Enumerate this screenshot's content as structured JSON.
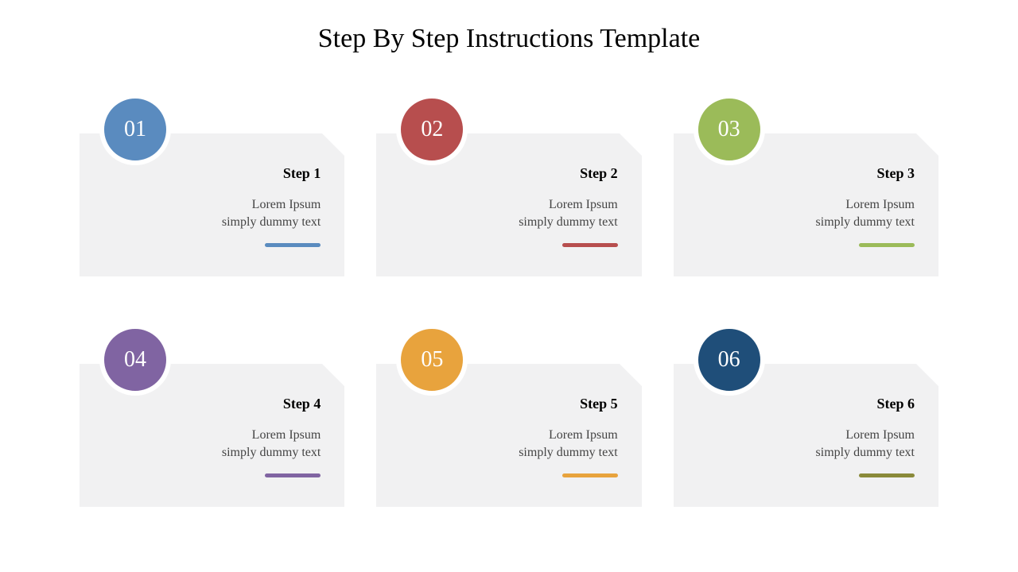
{
  "title": "Step By Step Instructions Template",
  "steps": [
    {
      "num": "01",
      "title": "Step 1",
      "body1": "Lorem Ipsum",
      "body2": "simply dummy text",
      "color": "#5a8bbf"
    },
    {
      "num": "02",
      "title": "Step 2",
      "body1": "Lorem Ipsum",
      "body2": "simply dummy text",
      "color": "#b74e4e"
    },
    {
      "num": "03",
      "title": "Step 3",
      "body1": "Lorem Ipsum",
      "body2": "simply dummy text",
      "color": "#9bbb59"
    },
    {
      "num": "04",
      "title": "Step 4",
      "body1": "Lorem Ipsum",
      "body2": "simply dummy text",
      "color": "#8064a2"
    },
    {
      "num": "05",
      "title": "Step 5",
      "body1": "Lorem Ipsum",
      "body2": "simply dummy text",
      "color": "#e8a33d"
    },
    {
      "num": "06",
      "title": "Step 6",
      "body1": "Lorem Ipsum",
      "body2": "simply dummy text",
      "color": "#1f4e79"
    }
  ],
  "underline_alt_color_6": "#8a8a3a"
}
